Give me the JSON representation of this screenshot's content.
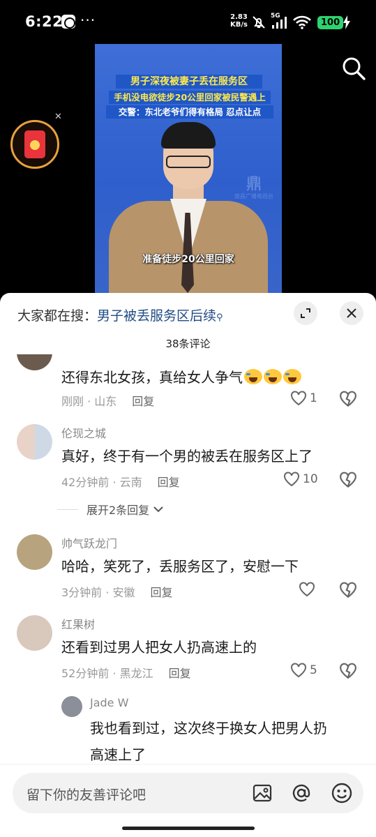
{
  "status_bar": {
    "time": "6:22",
    "more": "···",
    "net_speed_value": "2.83",
    "net_speed_unit": "KB/s",
    "network": "5G",
    "battery": "100"
  },
  "video": {
    "headline": "男子深夜被妻子丢在服务区",
    "subtitle_1": "手机没电欲徒步20公里回家被民警遇上",
    "subtitle_2": "交警：东北老爷们得有格局 忍点让点",
    "caption": "准备徒步20公里回家",
    "station_logo": "南昌广播电视台"
  },
  "sheet": {
    "search_prefix": "大家都在搜：",
    "search_keyword": "男子被丢服务区后续",
    "comment_count": "38条评论"
  },
  "comments": [
    {
      "nickname": "",
      "text": "还得东北女孩，真给女人争气",
      "time": "刚刚",
      "location": "山东",
      "reply": "回复",
      "likes": "1"
    },
    {
      "nickname": "伦现之城",
      "text": "真好，终于有一个男的被丢在服务区上了",
      "time": "42分钟前",
      "location": "云南",
      "reply": "回复",
      "likes": "10",
      "expand": "展开2条回复"
    },
    {
      "nickname": "帅气跃龙门",
      "text": "哈哈，笑死了，丢服务区了，安慰一下",
      "time": "3分钟前",
      "location": "安徽",
      "reply": "回复",
      "likes": ""
    },
    {
      "nickname": "红果树",
      "text": "还看到过男人把女人扔高速上的",
      "time": "52分钟前",
      "location": "黑龙江",
      "reply": "回复",
      "likes": "5"
    }
  ],
  "reply": {
    "nickname": "Jade W",
    "text_line1": "我也看到过，这次终于换女人把男人扔",
    "text_line2": "高速上了"
  },
  "input": {
    "placeholder": "留下你的友善评论吧"
  },
  "colors": {
    "keyword": "#214c84",
    "battery": "#2dd36f",
    "caption_yellow": "#ffe94a"
  }
}
